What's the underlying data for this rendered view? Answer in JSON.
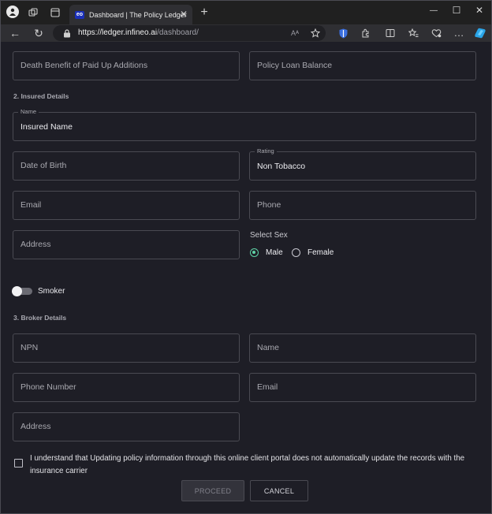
{
  "browser": {
    "tab_title": "Dashboard | The Policy Ledger",
    "tab_favicon_text": "eo",
    "url_host": "https://ledger.infineo.ai",
    "url_path": "/dashboard/",
    "reader_mode_text": "Aᴬ",
    "new_tab_symbol": "+",
    "close_symbol": "✕",
    "minimize_symbol": "—",
    "maximize_symbol": "☐",
    "window_close_symbol": "✕",
    "back_symbol": "←",
    "reload_symbol": "↻",
    "more_symbol": "…"
  },
  "policy": {
    "death_benefit_placeholder": "Death Benefit of Paid Up Additions",
    "loan_balance_placeholder": "Policy Loan Balance"
  },
  "insured": {
    "section_title": "2. Insured Details",
    "name_label": "Name",
    "name_value": "Insured Name",
    "dob_placeholder": "Date of Birth",
    "rating_label": "Rating",
    "rating_value": "Non Tobacco",
    "email_placeholder": "Email",
    "phone_placeholder": "Phone",
    "address_placeholder": "Address",
    "sex_label": "Select Sex",
    "sex_options": [
      "Male",
      "Female"
    ],
    "sex_selected": "Male",
    "smoker_label": "Smoker",
    "smoker_on": false
  },
  "broker": {
    "section_title": "3. Broker Details",
    "npn_placeholder": "NPN",
    "name_placeholder": "Name",
    "phone_placeholder": "Phone Number",
    "email_placeholder": "Email",
    "address_placeholder": "Address"
  },
  "consent": {
    "text": "I understand that Updating policy information through this online client portal does not automatically update the records with the insurance carrier",
    "checked": false
  },
  "actions": {
    "proceed_label": "PROCEED",
    "cancel_label": "CANCEL"
  },
  "colors": {
    "accent": "#5fd3a6",
    "background": "#1e1e26",
    "border": "#4a4a52"
  }
}
